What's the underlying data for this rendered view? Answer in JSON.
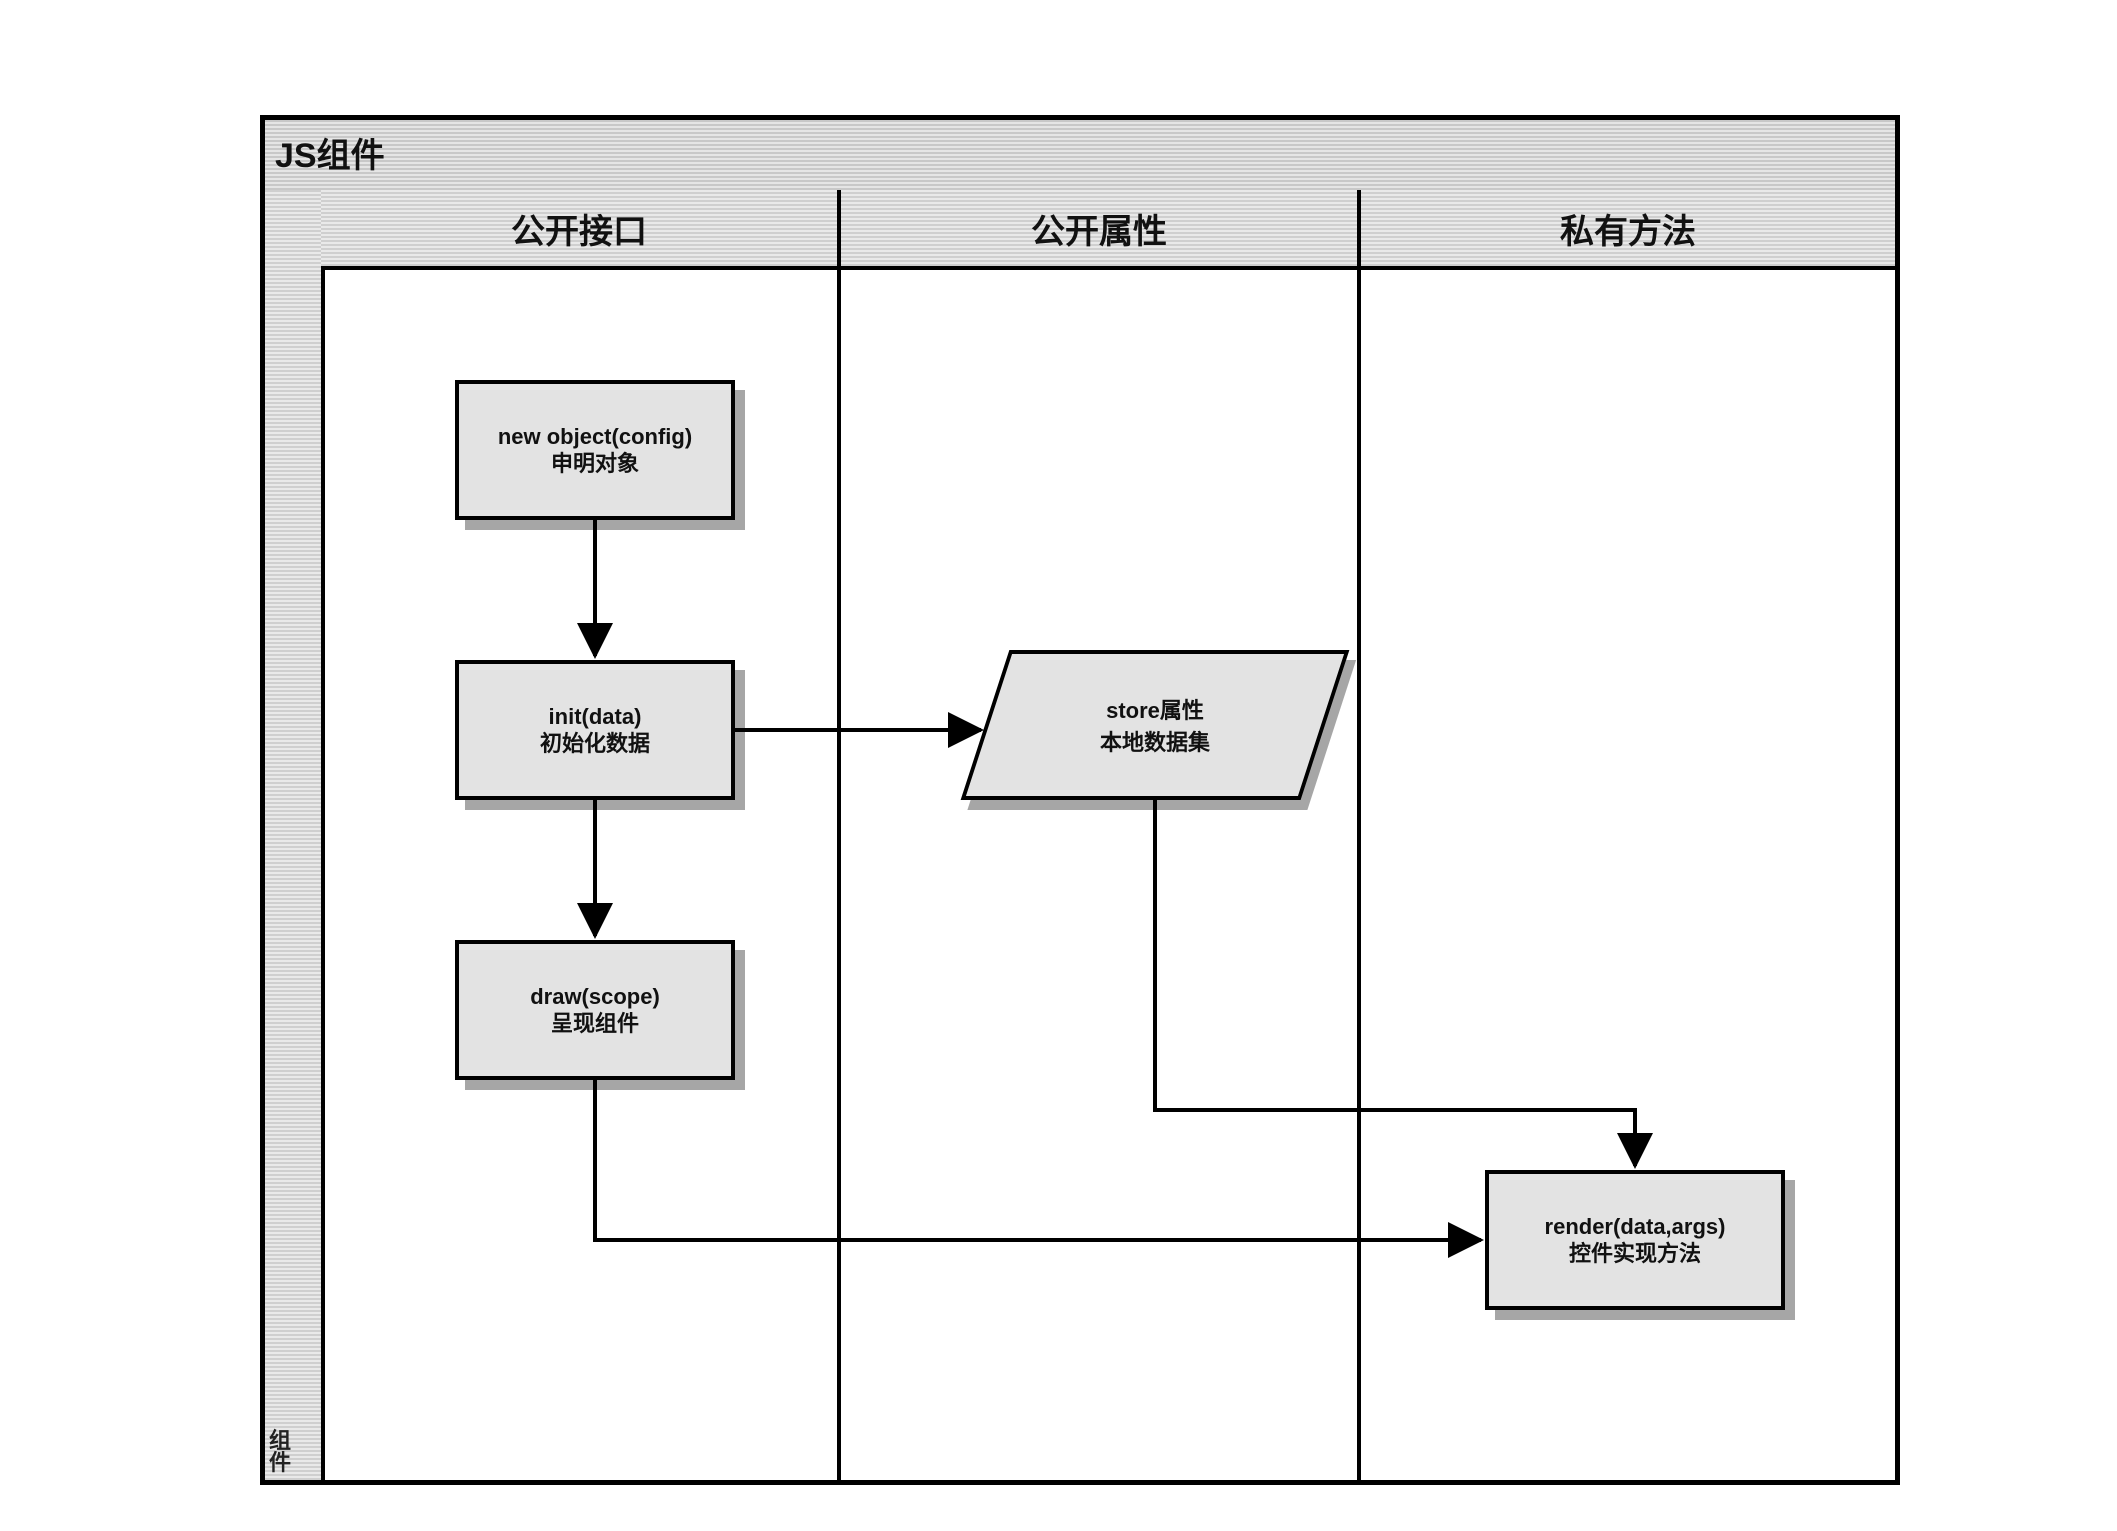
{
  "diagram": {
    "title": "JS组件",
    "sideLabel": "组\n件",
    "lanes": {
      "public_interface": "公开接口",
      "public_property": "公开属性",
      "private_method": "私有方法"
    },
    "nodes": {
      "new_object": {
        "line1": "new object(config)",
        "line2": "申明对象"
      },
      "init": {
        "line1": "init(data)",
        "line2": "初始化数据"
      },
      "draw": {
        "line1": "draw(scope)",
        "line2": "呈现组件"
      },
      "store": {
        "line1": "store属性",
        "line2": "本地数据集"
      },
      "render": {
        "line1": "render(data,args)",
        "line2": "控件实现方法"
      }
    },
    "edges": [
      {
        "from": "new_object",
        "to": "init",
        "type": "down"
      },
      {
        "from": "init",
        "to": "draw",
        "type": "down"
      },
      {
        "from": "init",
        "to": "store",
        "type": "right"
      },
      {
        "from": "store",
        "to": "render",
        "type": "down-right"
      },
      {
        "from": "draw",
        "to": "render",
        "type": "right"
      }
    ]
  }
}
